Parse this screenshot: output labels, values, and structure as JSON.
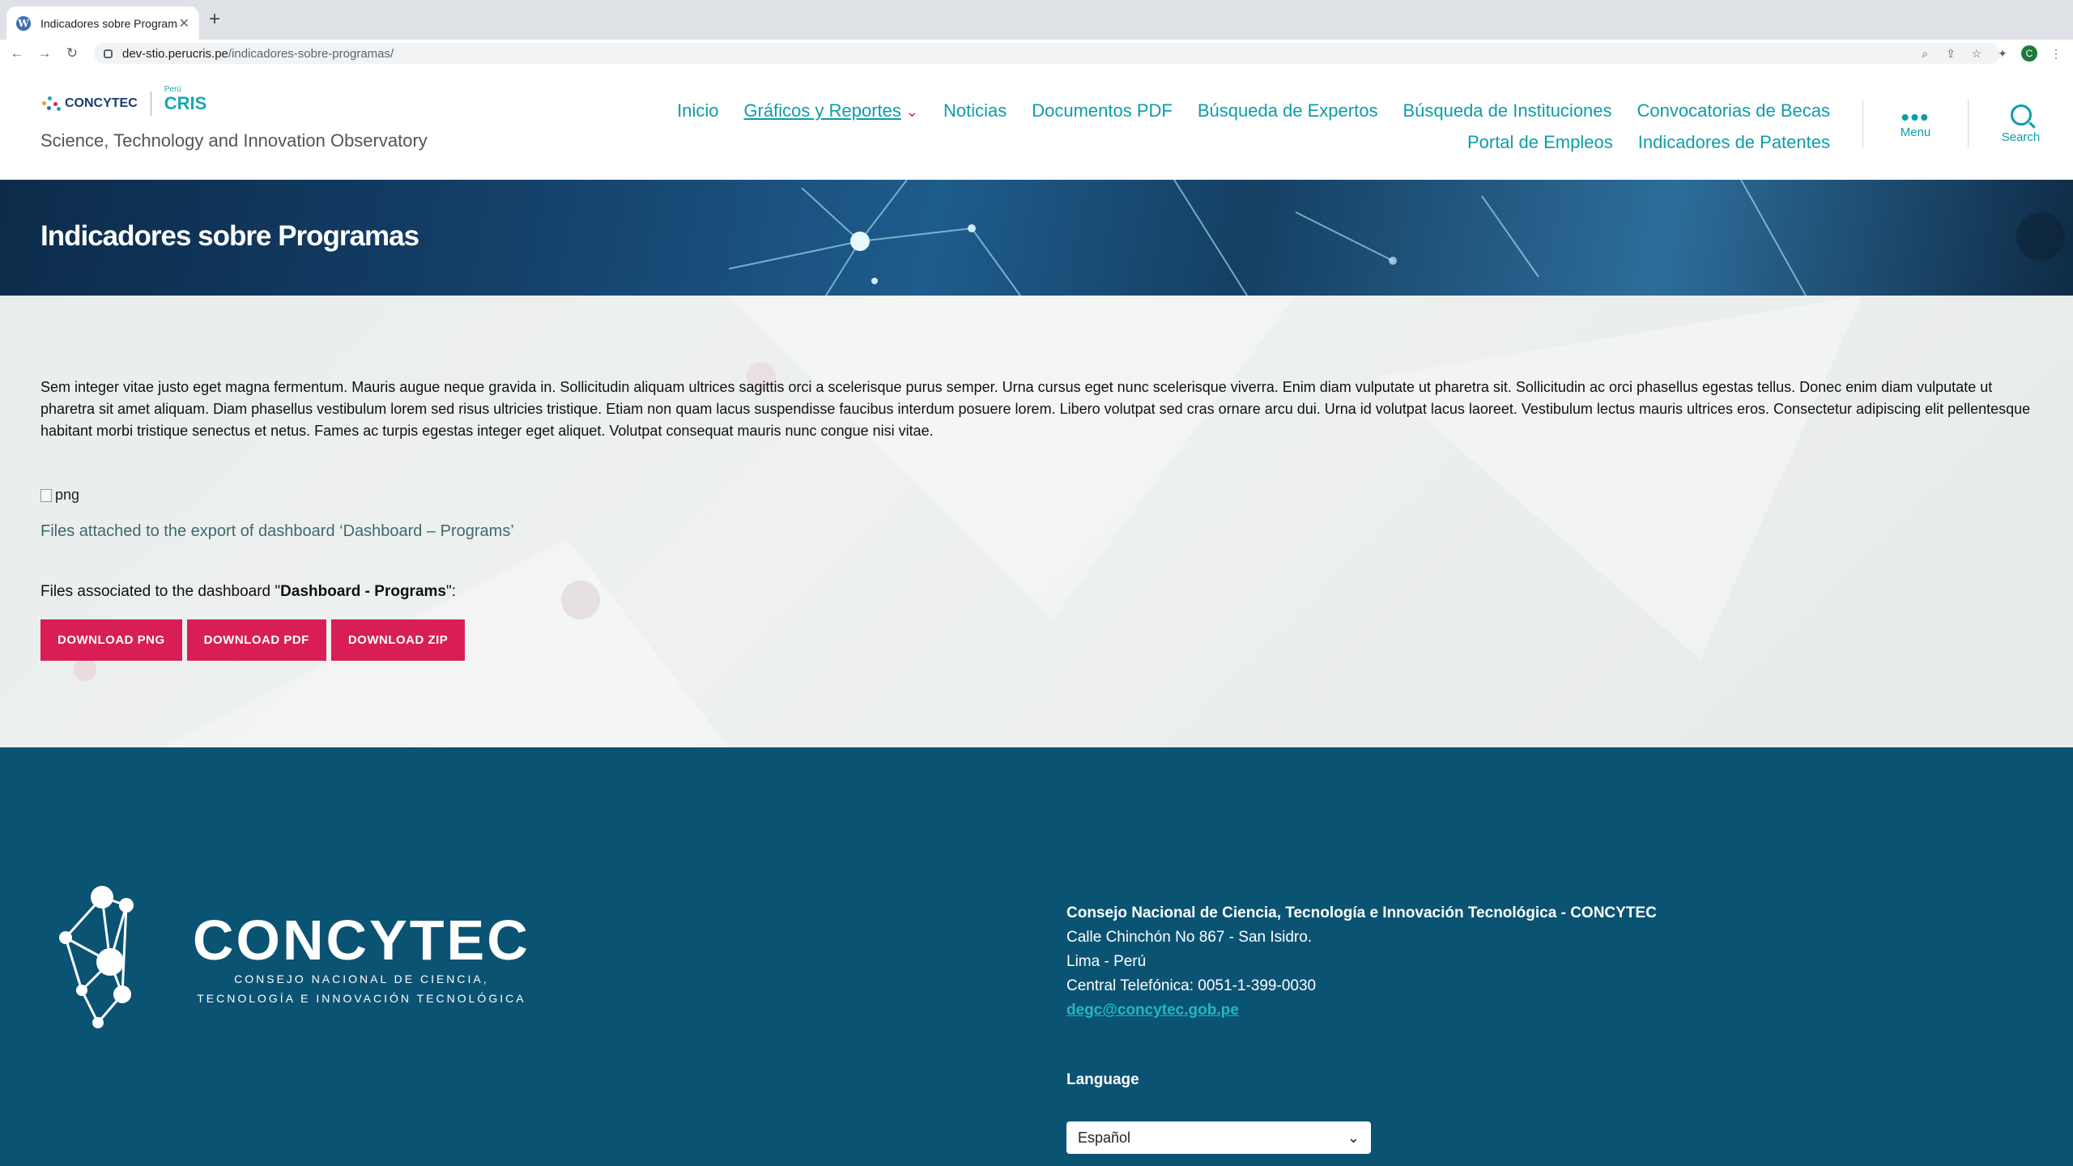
{
  "browser": {
    "tab_title": "Indicadores sobre Programas –",
    "tab_close": "✕",
    "new_tab": "+",
    "url_host": "dev-stio.perucris.pe",
    "url_path": "/indicadores-sobre-programas/",
    "profile_initial": "C"
  },
  "header": {
    "logo_concytec": "CONCYTEC",
    "logo_peru": "Perú",
    "logo_cris": "CRIS",
    "tagline": "Science, Technology and Innovation Observatory",
    "nav_row1": [
      "Inicio",
      "Gráficos y Reportes",
      "Noticias",
      "Documentos PDF",
      "Búsqueda de Expertos",
      "Búsqueda de Instituciones",
      "Convocatorias de Becas"
    ],
    "nav_row2": [
      "Portal de Empleos",
      "Indicadores de Patentes"
    ],
    "menu_label": "Menu",
    "search_label": "Search"
  },
  "hero": {
    "title": "Indicadores sobre Programas"
  },
  "content": {
    "intro": "Sem integer vitae justo eget magna fermentum. Mauris augue neque gravida in. Sollicitudin aliquam ultrices sagittis orci a scelerisque purus semper. Urna cursus eget nunc scelerisque viverra. Enim diam vulputate ut pharetra sit. Sollicitudin ac orci phasellus egestas tellus. Donec enim diam vulputate ut pharetra sit amet aliquam. Diam phasellus vestibulum lorem sed risus ultricies tristique. Etiam non quam lacus suspendisse faucibus interdum posuere lorem. Libero volutpat sed cras ornare arcu dui. Urna id volutpat lacus laoreet. Vestibulum lectus mauris ultrices eros. Consectetur adipiscing elit pellentesque habitant morbi tristique senectus et netus. Fames ac turpis egestas integer eget aliquet. Volutpat consequat mauris nunc congue nisi vitae.",
    "image_alt": "png",
    "caption": "Files attached to the export of dashboard ‘Dashboard – Programs’",
    "files_prefix": "Files associated to the dashboard \"",
    "files_name": "Dashboard - Programs",
    "files_suffix": "\":",
    "buttons": {
      "png": "DOWNLOAD PNG",
      "pdf": "DOWNLOAD PDF",
      "zip": "DOWNLOAD ZIP"
    }
  },
  "footer": {
    "brand": "CONCYTEC",
    "brand_sub1": "CONSEJO NACIONAL DE CIENCIA,",
    "brand_sub2": "TECNOLOGÍA E INNOVACIÓN TECNOLÓGICA",
    "org": "Consejo Nacional de Ciencia, Tecnología e Innovación Tecnológica - CONCYTEC",
    "address": "Calle Chinchón No 867 - San Isidro.",
    "city": "Lima - Perú",
    "phone": "Central Telefónica: 0051-1-399-0030",
    "email": "degc@concytec.gob.pe",
    "language_label": "Language",
    "language_value": "Español"
  },
  "colors": {
    "accent": "#0c9ea6",
    "button": "#d81e55",
    "footer_bg": "#0b5373"
  }
}
